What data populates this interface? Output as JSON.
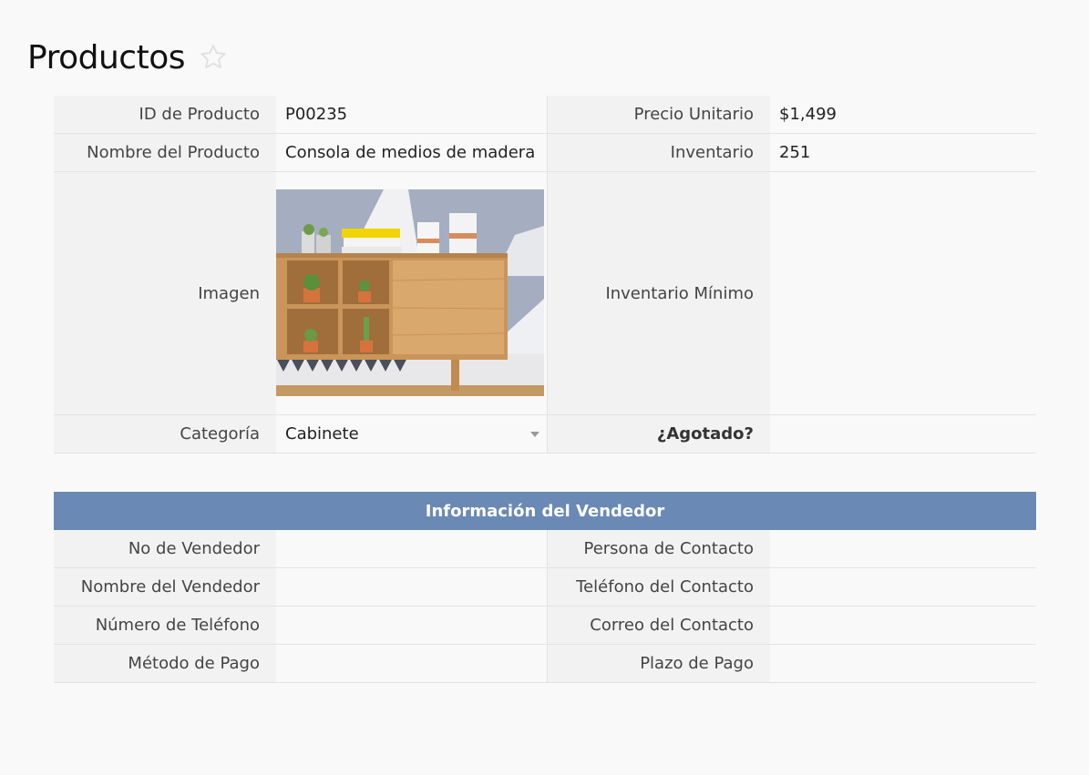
{
  "page": {
    "title": "Productos"
  },
  "product": {
    "id_label": "ID de Producto",
    "id_value": "P00235",
    "price_label": "Precio Unitario",
    "price_value": "$1,499",
    "name_label": "Nombre del Producto",
    "name_value": "Consola de medios de madera",
    "inventory_label": "Inventario",
    "inventory_value": "251",
    "image_label": "Imagen",
    "min_inventory_label": "Inventario Mínimo",
    "min_inventory_value": "",
    "category_label": "Categoría",
    "category_value": "Cabinete",
    "out_of_stock_label": "¿Agotado?",
    "out_of_stock_value": ""
  },
  "vendor": {
    "header": "Información del Vendedor",
    "fields": [
      {
        "label": "No de Vendedor",
        "value": ""
      },
      {
        "label": "Persona de Contacto",
        "value": ""
      },
      {
        "label": "Nombre del Vendedor",
        "value": ""
      },
      {
        "label": "Teléfono del Contacto",
        "value": ""
      },
      {
        "label": "Número de Teléfono",
        "value": ""
      },
      {
        "label": "Correo del Contacto",
        "value": ""
      },
      {
        "label": "Método de Pago",
        "value": ""
      },
      {
        "label": "Plazo de Pago",
        "value": ""
      }
    ]
  },
  "icons": {
    "favorite": "star-outline-icon",
    "dropdown": "chevron-down-icon"
  },
  "colors": {
    "header_bg": "#6a89b5",
    "label_bg": "#f2f2f2",
    "page_bg": "#f9f9f9"
  }
}
